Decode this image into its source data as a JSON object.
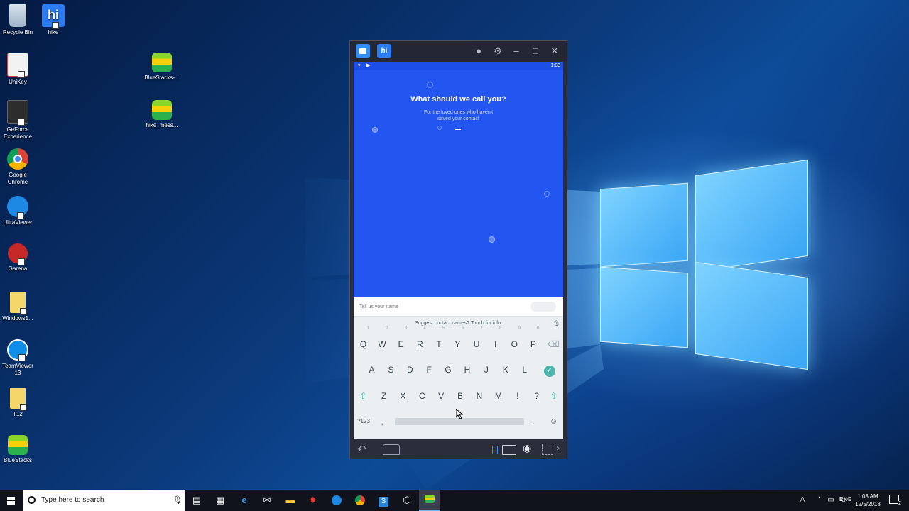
{
  "desktop": {
    "icons": [
      {
        "label": "Recycle Bin",
        "icon": "recycle-bin-icon"
      },
      {
        "label": "hike",
        "icon": "hike-icon"
      },
      {
        "label": "UniKey",
        "icon": "unikey-icon"
      },
      {
        "label": "BlueStacks-...",
        "icon": "bluestacks-icon"
      },
      {
        "label": "GeForce Experience",
        "icon": "geforce-icon"
      },
      {
        "label": "hike_mess...",
        "icon": "bluestacks-icon"
      },
      {
        "label": "Google Chrome",
        "icon": "chrome-icon"
      },
      {
        "label": "UltraViewer",
        "icon": "ultraviewer-icon"
      },
      {
        "label": "Garena",
        "icon": "garena-icon"
      },
      {
        "label": "Windows1...",
        "icon": "folder-icon"
      },
      {
        "label": "TeamViewer 13",
        "icon": "teamviewer-icon"
      },
      {
        "label": "T12",
        "icon": "folder-icon"
      },
      {
        "label": "BlueStacks",
        "icon": "bluestacks-icon"
      }
    ]
  },
  "bluestacks": {
    "title_tabs": [
      "home-tab-icon",
      "hike-tab-icon"
    ],
    "controls": [
      "account-icon",
      "settings-icon",
      "minimize-icon",
      "maximize-icon",
      "close-icon"
    ],
    "status_time": "1:03",
    "app": {
      "heading": "What should we call you?",
      "subheading_line1": "For the loved ones who haven't",
      "subheading_line2": "saved your contact",
      "name_placeholder": "Tell us your name"
    },
    "keyboard": {
      "suggestion": "Suggest contact names? Touch for info.",
      "row1": [
        {
          "k": "Q",
          "h": "1"
        },
        {
          "k": "W",
          "h": "2"
        },
        {
          "k": "E",
          "h": "3"
        },
        {
          "k": "R",
          "h": "4"
        },
        {
          "k": "T",
          "h": "5"
        },
        {
          "k": "Y",
          "h": "6"
        },
        {
          "k": "U",
          "h": "7"
        },
        {
          "k": "I",
          "h": "8"
        },
        {
          "k": "O",
          "h": "9"
        },
        {
          "k": "P",
          "h": "0"
        }
      ],
      "row2": [
        "A",
        "S",
        "D",
        "F",
        "G",
        "H",
        "J",
        "K",
        "L"
      ],
      "row3": [
        "Z",
        "X",
        "C",
        "V",
        "B",
        "N",
        "M",
        "!",
        "?"
      ],
      "symbols_key": "?123",
      "comma_key": ",",
      "period_key": "."
    },
    "colors": {
      "app_blue": "#2356f0",
      "accent_teal": "#4db6ac"
    }
  },
  "taskbar": {
    "search_placeholder": "Type here to search",
    "pinned": [
      "task-view-icon",
      "store-icon",
      "edge-icon",
      "mail-icon",
      "file-explorer-icon",
      "garena-icon",
      "ultraviewer-icon",
      "chrome-icon",
      "skype-icon",
      "app-icon",
      "bluestacks-icon"
    ],
    "language": "ENG",
    "time": "1:03 AM",
    "date": "12/5/2018",
    "notifications_count": "2"
  }
}
